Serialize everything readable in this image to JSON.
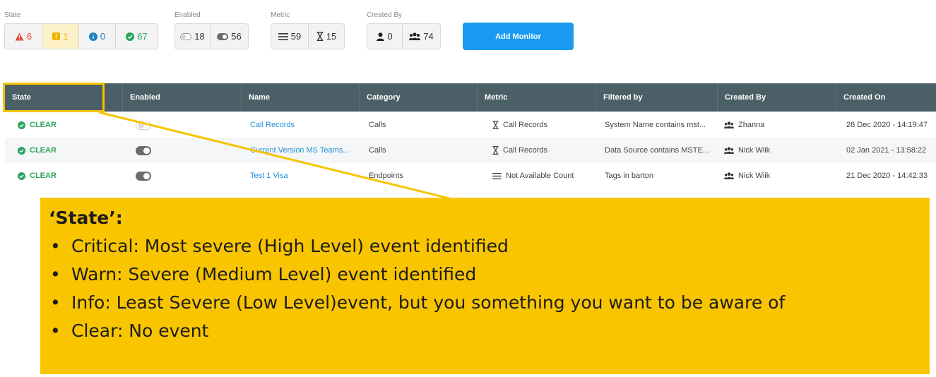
{
  "filters": {
    "state": {
      "label": "State",
      "items": [
        {
          "icon": "warning-triangle-icon",
          "count": "6",
          "color": "#e34b2f"
        },
        {
          "icon": "warning-square-icon",
          "count": "1",
          "color": "#f2b300"
        },
        {
          "icon": "info-circle-icon",
          "count": "0",
          "color": "#1f7fc4"
        },
        {
          "icon": "check-circle-icon",
          "count": "67",
          "color": "#2aa55a"
        }
      ]
    },
    "enabled": {
      "label": "Enabled",
      "items": [
        {
          "icon": "toggle-off-icon",
          "count": "18"
        },
        {
          "icon": "toggle-on-icon",
          "count": "56"
        }
      ]
    },
    "metric": {
      "label": "Metric",
      "items": [
        {
          "icon": "lines-icon",
          "count": "59"
        },
        {
          "icon": "hourglass-icon",
          "count": "15"
        }
      ]
    },
    "created_by": {
      "label": "Created By",
      "items": [
        {
          "icon": "user-icon",
          "count": "0"
        },
        {
          "icon": "users-icon",
          "count": "74"
        }
      ]
    }
  },
  "add_monitor_label": "Add Monitor",
  "table": {
    "columns": [
      "State",
      "Enabled",
      "Name",
      "Category",
      "Metric",
      "Filtered by",
      "Created By",
      "Created On"
    ],
    "rows": [
      {
        "state": "CLEAR",
        "enabled": false,
        "name": "Call Records",
        "category": "Calls",
        "metric_icon": "hourglass-icon",
        "metric": "Call Records",
        "filtered_by": "System Name contains mst...",
        "created_by": "Zhanna",
        "created_on": "28 Dec 2020 - 14:19:47"
      },
      {
        "state": "CLEAR",
        "enabled": true,
        "name": "Current Version MS Teams...",
        "category": "Calls",
        "metric_icon": "hourglass-icon",
        "metric": "Call Records",
        "filtered_by": "Data Source contains MSTE...",
        "created_by": "Nick Wiik",
        "created_on": "02 Jan 2021 - 13:58:22"
      },
      {
        "state": "CLEAR",
        "enabled": true,
        "name": "Test 1 Visa",
        "category": "Endpoints",
        "metric_icon": "lines-icon",
        "metric": "Not Available Count",
        "filtered_by": "Tags in barton",
        "created_by": "Nick Wiik",
        "created_on": "21 Dec 2020 - 14:42:33"
      }
    ]
  },
  "callout": {
    "title": "‘State’:",
    "bullets": [
      "Critical: Most severe (High Level) event identified",
      "Warn: Severe (Medium Level) event identified",
      "Info: Least Severe (Low Level)event,  but you something you want to be aware of",
      "Clear: No event"
    ]
  },
  "colors": {
    "accent": "#1a9af0",
    "header_bg": "#4b5f66",
    "callout_bg": "#f9c500",
    "clear_green": "#2aa55a"
  }
}
